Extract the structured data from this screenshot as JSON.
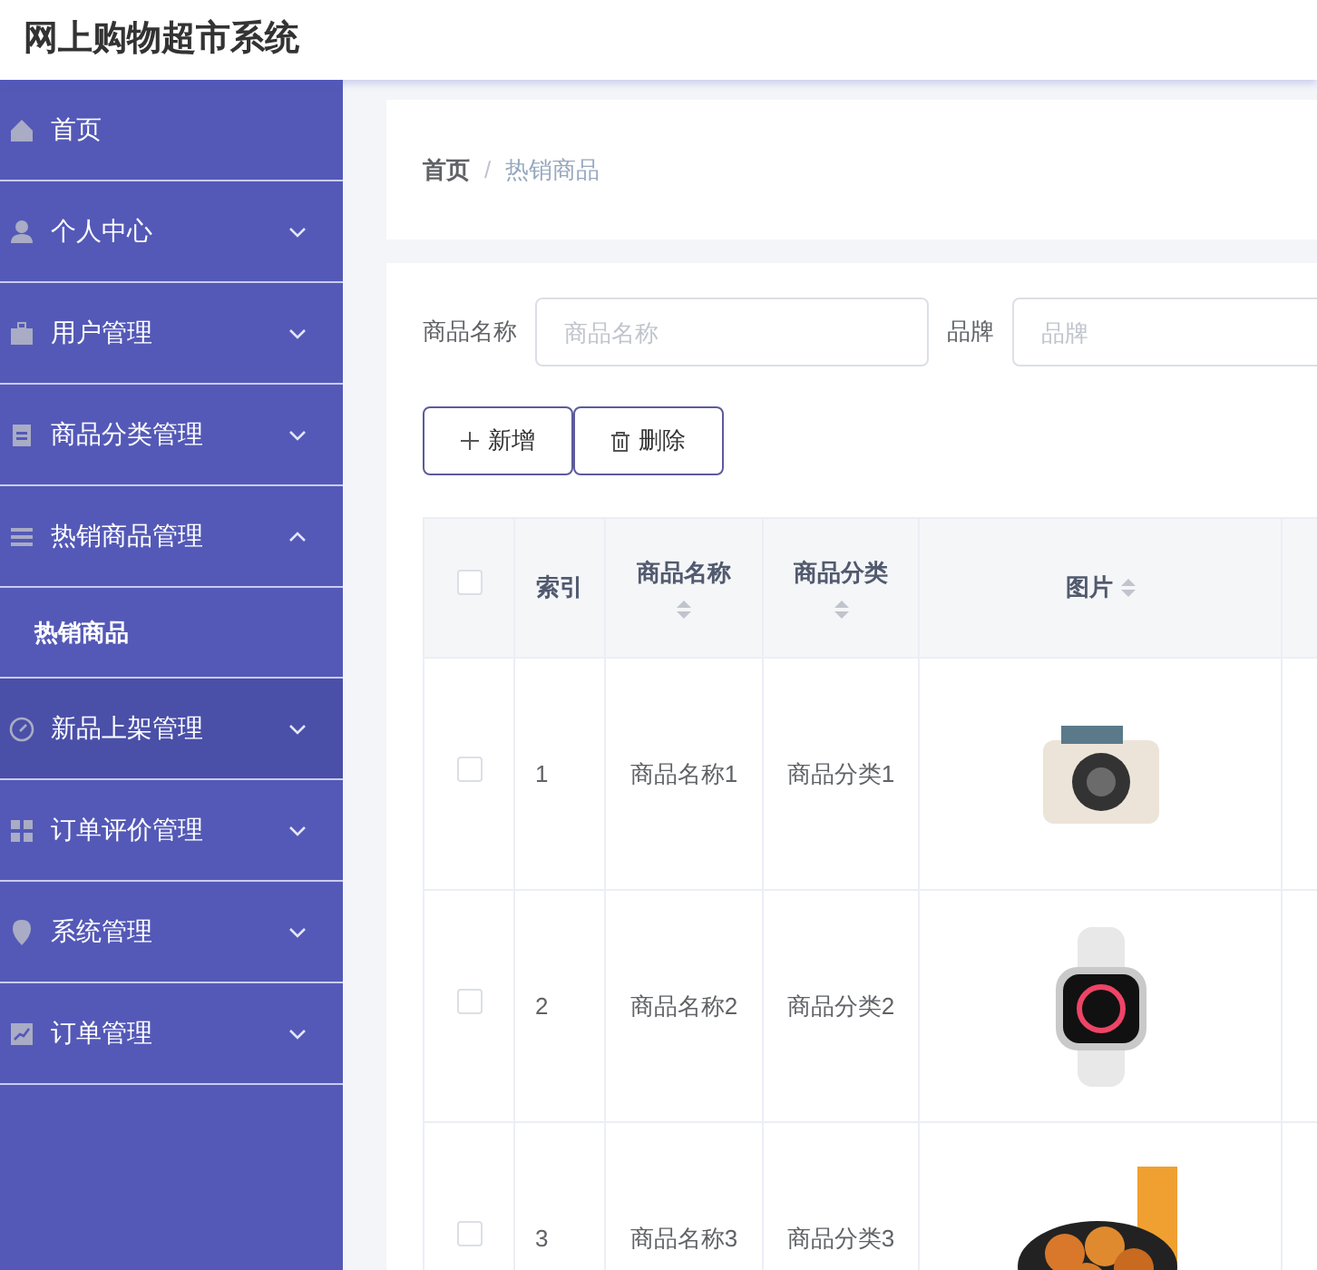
{
  "header": {
    "title": "网上购物超市系统"
  },
  "sidebar": {
    "items": [
      {
        "label": "首页",
        "expandable": false,
        "hovered": false
      },
      {
        "label": "个人中心",
        "expandable": true,
        "expanded": false,
        "hovered": false
      },
      {
        "label": "用户管理",
        "expandable": true,
        "expanded": false,
        "hovered": false
      },
      {
        "label": "商品分类管理",
        "expandable": true,
        "expanded": false,
        "hovered": false
      },
      {
        "label": "热销商品管理",
        "expandable": true,
        "expanded": true,
        "hovered": false,
        "children": [
          {
            "label": "热销商品"
          }
        ]
      },
      {
        "label": "新品上架管理",
        "expandable": true,
        "expanded": false,
        "hovered": true
      },
      {
        "label": "订单评价管理",
        "expandable": true,
        "expanded": false,
        "hovered": false
      },
      {
        "label": "系统管理",
        "expandable": true,
        "expanded": false,
        "hovered": false
      },
      {
        "label": "订单管理",
        "expandable": true,
        "expanded": false,
        "hovered": false
      }
    ]
  },
  "breadcrumb": [
    "首页",
    "热销商品"
  ],
  "breadcrumb_separator": "/",
  "search": {
    "fields": [
      {
        "label": "商品名称",
        "placeholder": "商品名称"
      },
      {
        "label": "品牌",
        "placeholder": "品牌"
      }
    ]
  },
  "actions": [
    {
      "kind": "add",
      "label": "新增"
    },
    {
      "kind": "delete",
      "label": "删除"
    }
  ],
  "table": {
    "select_all_checked": false,
    "columns": [
      {
        "label": "索引",
        "sortable": false
      },
      {
        "label": "商品名称",
        "sortable": true
      },
      {
        "label": "商品分类",
        "sortable": true
      },
      {
        "label": "图片",
        "sortable": true
      }
    ],
    "rows": [
      {
        "checked": false,
        "index": "1",
        "name": "商品名称1",
        "category": "商品分类1"
      },
      {
        "checked": false,
        "index": "2",
        "name": "商品名称2",
        "category": "商品分类2"
      },
      {
        "checked": false,
        "index": "3",
        "name": "商品名称3",
        "category": "商品分类3"
      }
    ]
  }
}
